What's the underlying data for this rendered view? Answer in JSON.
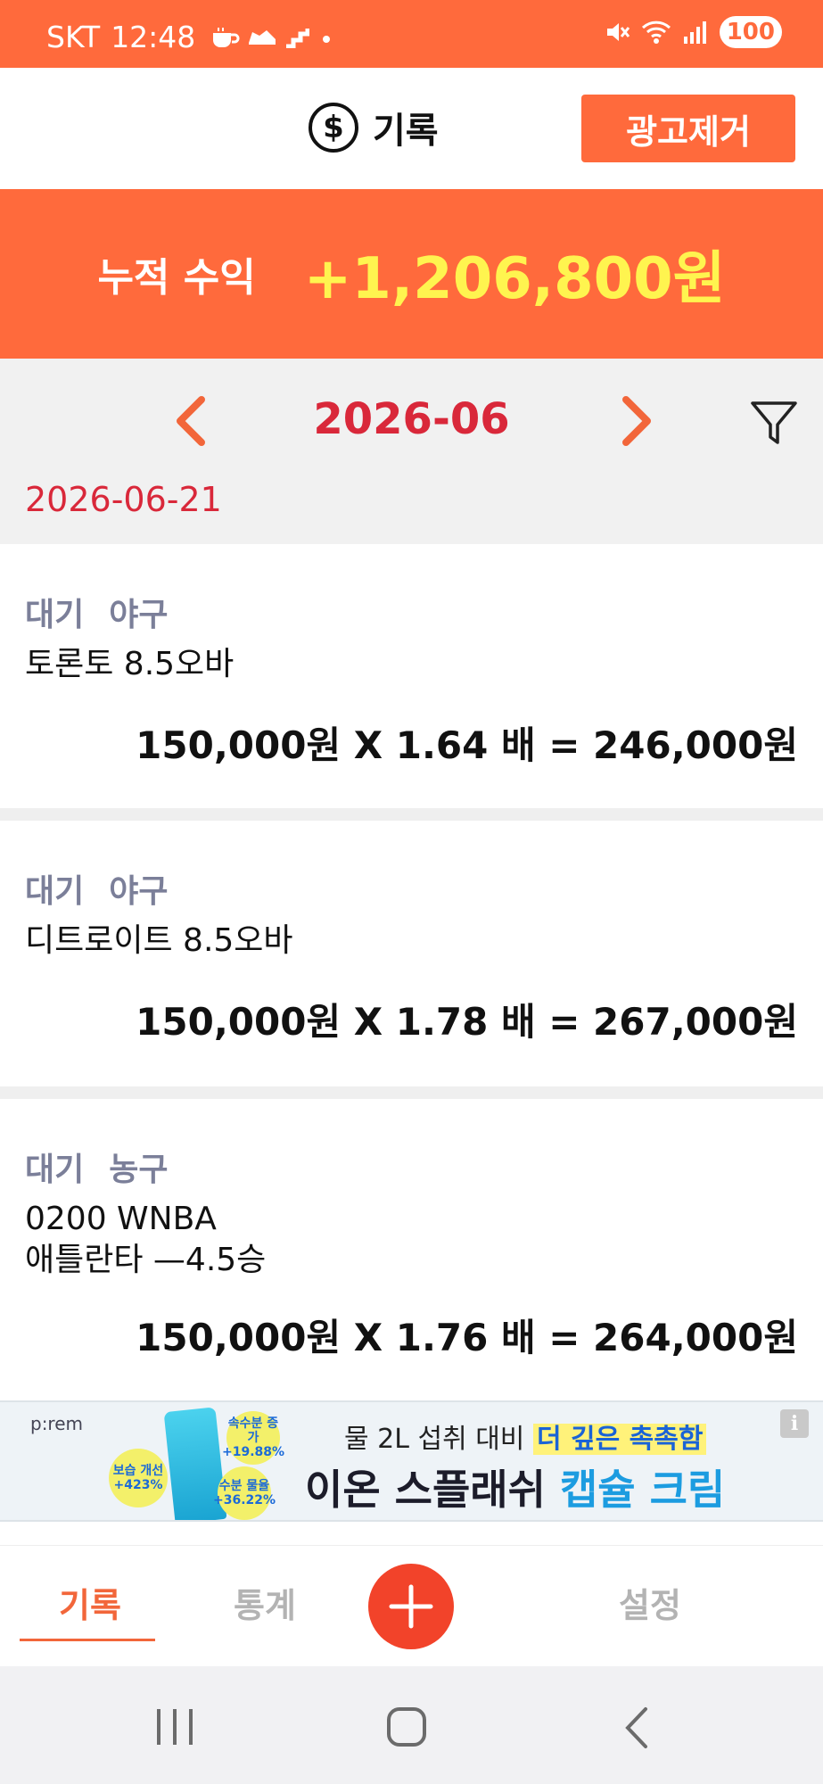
{
  "status_bar": {
    "carrier": "SKT",
    "time": "12:48",
    "battery": "100"
  },
  "header": {
    "title": "기록",
    "ad_remove_label": "광고제거"
  },
  "summary": {
    "label": "누적 수익",
    "value": "+1,206,800원"
  },
  "month_nav": {
    "month": "2026-06"
  },
  "date_group": "2026-06-21",
  "records": [
    {
      "status": "대기",
      "sport": "야구",
      "title_lines": [
        "토론토 8.5오바"
      ],
      "amount": "150,000원 X 1.64 배 = 246,000원"
    },
    {
      "status": "대기",
      "sport": "야구",
      "title_lines": [
        "디트로이트 8.5오바"
      ],
      "amount": "150,000원 X 1.78 배 = 267,000원"
    },
    {
      "status": "대기",
      "sport": "농구",
      "title_lines": [
        "0200 WNBA",
        "애틀란타 —4.5승"
      ],
      "amount": "150,000원 X 1.76 배 = 264,000원"
    }
  ],
  "ad": {
    "brand": "p:rem",
    "bubble1": [
      "보습 개선",
      "+423%"
    ],
    "bubble2": [
      "속수분 증가",
      "+19.88%"
    ],
    "bubble3": [
      "수분 물율",
      "+36.22%"
    ],
    "line1_prefix": "물 2L 섭취 대비",
    "line1_highlight": "더 깊은 촉촉함",
    "line2_prefix": "이온 스플래쉬",
    "line2_highlight": "캡슐 크림",
    "info_label": "i"
  },
  "bottom_nav": {
    "tab_records": "기록",
    "tab_stats": "통계",
    "tab_settings": "설정"
  },
  "colors": {
    "accent": "#ff6a3c",
    "profit": "#fff44f",
    "date_red": "#d9283a",
    "tag_gray": "#7b7f99"
  }
}
